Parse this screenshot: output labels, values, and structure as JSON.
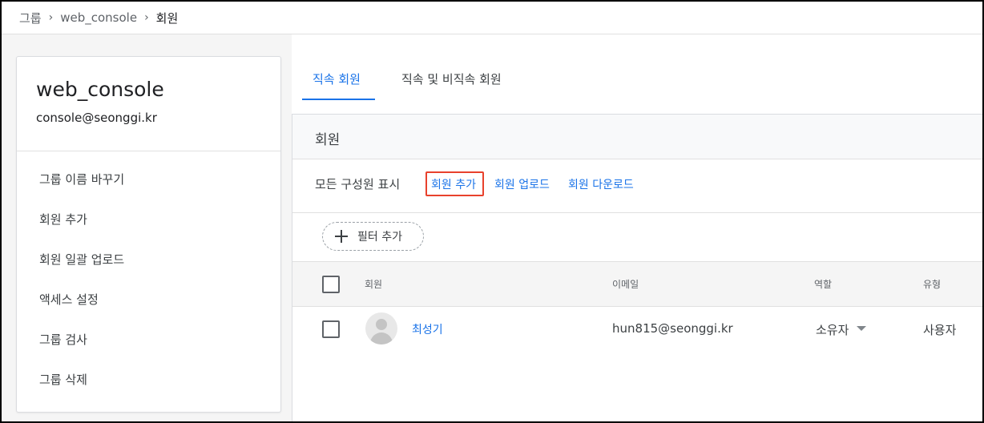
{
  "breadcrumb": {
    "items": [
      "그룹",
      "web_console",
      "회원"
    ],
    "separator": "›"
  },
  "group": {
    "name": "web_console",
    "email": "console@seonggi.kr"
  },
  "sidebar": {
    "items": [
      {
        "label": "그룹 이름 바꾸기"
      },
      {
        "label": "회원 추가"
      },
      {
        "label": "회원 일괄 업로드"
      },
      {
        "label": "액세스 설정"
      },
      {
        "label": "그룹 검사"
      },
      {
        "label": "그룹 삭제"
      }
    ]
  },
  "tabs": [
    {
      "label": "직속 회원",
      "active": true
    },
    {
      "label": "직속 및 비직속 회원",
      "active": false
    }
  ],
  "section": {
    "title": "회원",
    "show_all": "모든 구성원 표시",
    "actions": {
      "add": "회원 추가",
      "upload": "회원 업로드",
      "download": "회원 다운로드"
    },
    "filter_label": "필터 추가"
  },
  "table": {
    "columns": {
      "member": "회원",
      "email": "이메일",
      "role": "역할",
      "type": "유형"
    },
    "rows": [
      {
        "name": "최성기",
        "email": "hun815@seonggi.kr",
        "role": "소유자",
        "type": "사용자"
      }
    ]
  },
  "colors": {
    "accent": "#1a73e8",
    "highlight_border": "#e8412c"
  },
  "icons": [
    "chevron-right-icon",
    "plus-icon",
    "checkbox-icon",
    "avatar-icon",
    "dropdown-caret-icon"
  ]
}
